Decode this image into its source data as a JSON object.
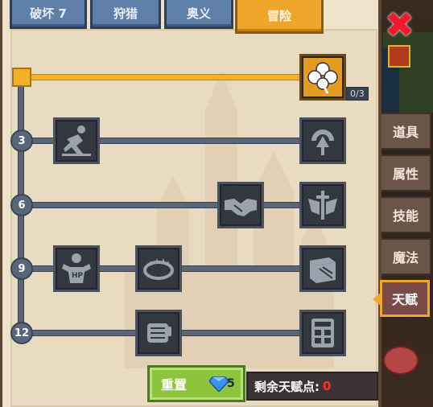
{
  "tabs": [
    {
      "label": "破坏 7"
    },
    {
      "label": "狩猎"
    },
    {
      "label": "奥义"
    },
    {
      "label": "冒险"
    }
  ],
  "side_tabs": [
    {
      "label": "道具"
    },
    {
      "label": "属性"
    },
    {
      "label": "技能"
    },
    {
      "label": "魔法"
    },
    {
      "label": "天赋"
    }
  ],
  "tree": {
    "levels": [
      "3",
      "6",
      "9",
      "12"
    ],
    "top_talent": {
      "icon": "clover-icon",
      "count": "0/3"
    },
    "talents": [
      {
        "icon": "jumping-runner-icon"
      },
      {
        "icon": "clamp-arrow-icon"
      },
      {
        "icon": "handshake-icon"
      },
      {
        "icon": "winged-sword-icon"
      },
      {
        "icon": "hp-strongman-icon"
      },
      {
        "icon": "bear-trap-icon"
      },
      {
        "icon": "crate-icon"
      },
      {
        "icon": "fist-icon"
      },
      {
        "icon": "calculator-icon"
      }
    ]
  },
  "footer": {
    "reset_label": "重置",
    "gem_cost": "5",
    "points_label": "剩余天赋点:",
    "points_value": "0"
  },
  "colors": {
    "accent_gold": "#f0a62a",
    "tab_blue": "#5d7fa8",
    "reset_green": "#8cc43c",
    "points_red": "#ff2d2d"
  }
}
